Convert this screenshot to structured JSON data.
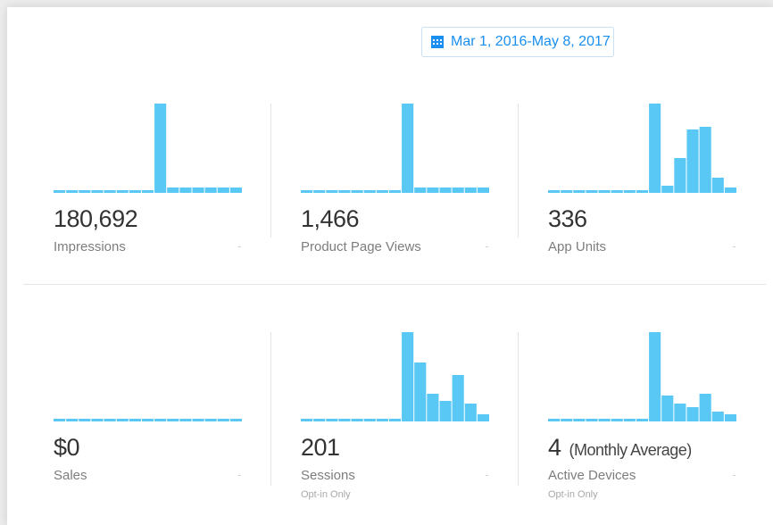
{
  "date_range": {
    "label": "Mar 1, 2016-May 8, 2017",
    "icon": "calendar-icon",
    "accent": "#1a8ff0"
  },
  "bar_color": "#5ac8f5",
  "metrics": [
    {
      "key": "impressions",
      "value": "180,692",
      "suffix": "",
      "label": "Impressions",
      "note": "",
      "bars": [
        0.02,
        0.02,
        0.02,
        0.02,
        0.02,
        0.02,
        0.02,
        0.02,
        1.0,
        0.06,
        0.06,
        0.06,
        0.06,
        0.06,
        0.06
      ]
    },
    {
      "key": "product_page_views",
      "value": "1,466",
      "suffix": "",
      "label": "Product Page Views",
      "note": "",
      "bars": [
        0.02,
        0.02,
        0.02,
        0.02,
        0.02,
        0.02,
        0.02,
        0.02,
        1.0,
        0.06,
        0.06,
        0.06,
        0.06,
        0.06,
        0.06
      ]
    },
    {
      "key": "app_units",
      "value": "336",
      "suffix": "",
      "label": "App Units",
      "note": "",
      "bars": [
        0.02,
        0.02,
        0.02,
        0.02,
        0.02,
        0.02,
        0.02,
        0.02,
        1.0,
        0.08,
        0.39,
        0.71,
        0.74,
        0.17,
        0.06
      ]
    },
    {
      "key": "sales",
      "value": "$0",
      "suffix": "",
      "label": "Sales",
      "note": "",
      "bars": [
        0.02,
        0.02,
        0.02,
        0.02,
        0.02,
        0.02,
        0.02,
        0.02,
        0.02,
        0.02,
        0.02,
        0.02,
        0.02,
        0.02,
        0.02
      ]
    },
    {
      "key": "sessions",
      "value": "201",
      "suffix": "",
      "label": "Sessions",
      "note": "Opt-in Only",
      "bars": [
        0.02,
        0.02,
        0.02,
        0.02,
        0.02,
        0.02,
        0.02,
        0.02,
        1.0,
        0.66,
        0.31,
        0.23,
        0.52,
        0.2,
        0.08
      ]
    },
    {
      "key": "active_devices",
      "value": "4",
      "suffix": "(Monthly Average)",
      "label": "Active Devices",
      "note": "Opt-in Only",
      "bars": [
        0.02,
        0.02,
        0.02,
        0.02,
        0.02,
        0.02,
        0.02,
        0.02,
        1.0,
        0.29,
        0.2,
        0.16,
        0.31,
        0.11,
        0.08
      ]
    }
  ]
}
